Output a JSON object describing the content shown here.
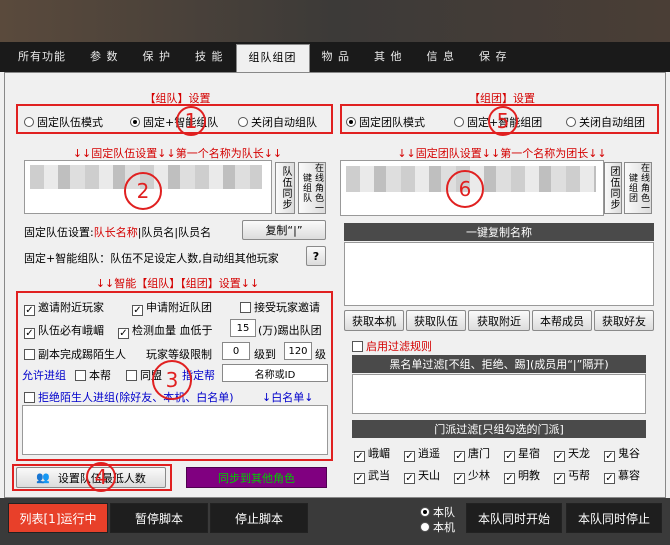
{
  "tabs": [
    "所有功能",
    "参 数",
    "保 护",
    "技 能",
    "组队组团",
    "物 品",
    "其 他",
    "信 息",
    "保 存"
  ],
  "team": {
    "title": "【组队】设置",
    "modes": [
      "固定队伍模式",
      "固定+智能组队",
      "关闭自动组队"
    ],
    "hint": "↓↓固定队伍设置↓↓第一个名称为队长↓↓",
    "vbtn1": "队伍同步",
    "vbtn2": "在线角色一键组队",
    "fixed_label": "固定队伍设置:",
    "fixed_red": "队长名称",
    "fixed_rest": "|队员名|队员名",
    "copy_btn": "复制“|”",
    "smart_note": "固定+智能组队：队伍不足设定人数,自动组其他玩家",
    "q_btn": "?"
  },
  "smart": {
    "title": "↓↓智能【组队】【组团】设置↓↓",
    "invite_nearby": "邀请附近玩家",
    "apply_nearby": "申请附近队团",
    "accept_invite": "接受玩家邀请",
    "must_emei": "队伍必有峨嵋",
    "check_hp": "检测血量 血低于",
    "hp_value": "15",
    "hp_unit": "(万)踢出队团",
    "kick_stranger": "副本完成踢陌生人",
    "level_limit": "玩家等级限制",
    "lvl_min": "0",
    "lvl_to": "级到",
    "lvl_max": "120",
    "lvl_unit": "级",
    "allow_join": "允许进组",
    "this_guild": "本帮",
    "ally": "同盟",
    "assign_guild": "指定帮",
    "name_or_id": "名称或ID",
    "reject": "拒绝陌生人进组(除好友、本机、白名单)",
    "whitelist": "↓白名单↓",
    "set_min": "设置队伍最低人数",
    "sync_other": "同步到其他角色"
  },
  "group": {
    "title": "【组团】设置",
    "modes": [
      "固定团队模式",
      "固定+智能组团",
      "关闭自动组团"
    ],
    "hint": "↓↓固定团队设置↓↓第一个名称为团长↓↓",
    "vbtn1": "团伍同步",
    "vbtn2": "在线角色一键组团",
    "copy_name": "一键复制名称",
    "get_btns": [
      "获取本机",
      "获取队伍",
      "获取附近",
      "本帮成员",
      "获取好友"
    ],
    "enable_filter": "启用过滤规则",
    "blacklist": "黑名单过滤[不组、拒绝、踢](成员用“|”隔开)",
    "sect_filter": "门派过滤[只组勾选的门派]",
    "sects": [
      "峨嵋",
      "逍遥",
      "唐门",
      "星宿",
      "天龙",
      "鬼谷",
      "武当",
      "天山",
      "少林",
      "明教",
      "丐帮",
      "慕容"
    ]
  },
  "bottom": {
    "list": "列表[1]运行中",
    "pause": "暂停脚本",
    "stop": "停止脚本",
    "radio1": "本队",
    "radio2": "本机",
    "start_all": "本队同时开始",
    "stop_all": "本队同时停止"
  },
  "markers": [
    "1",
    "2",
    "3",
    "4",
    "5",
    "6"
  ],
  "colors": {
    "red": "#e02020",
    "purple": "#800080",
    "green_text": "#00cc00"
  }
}
